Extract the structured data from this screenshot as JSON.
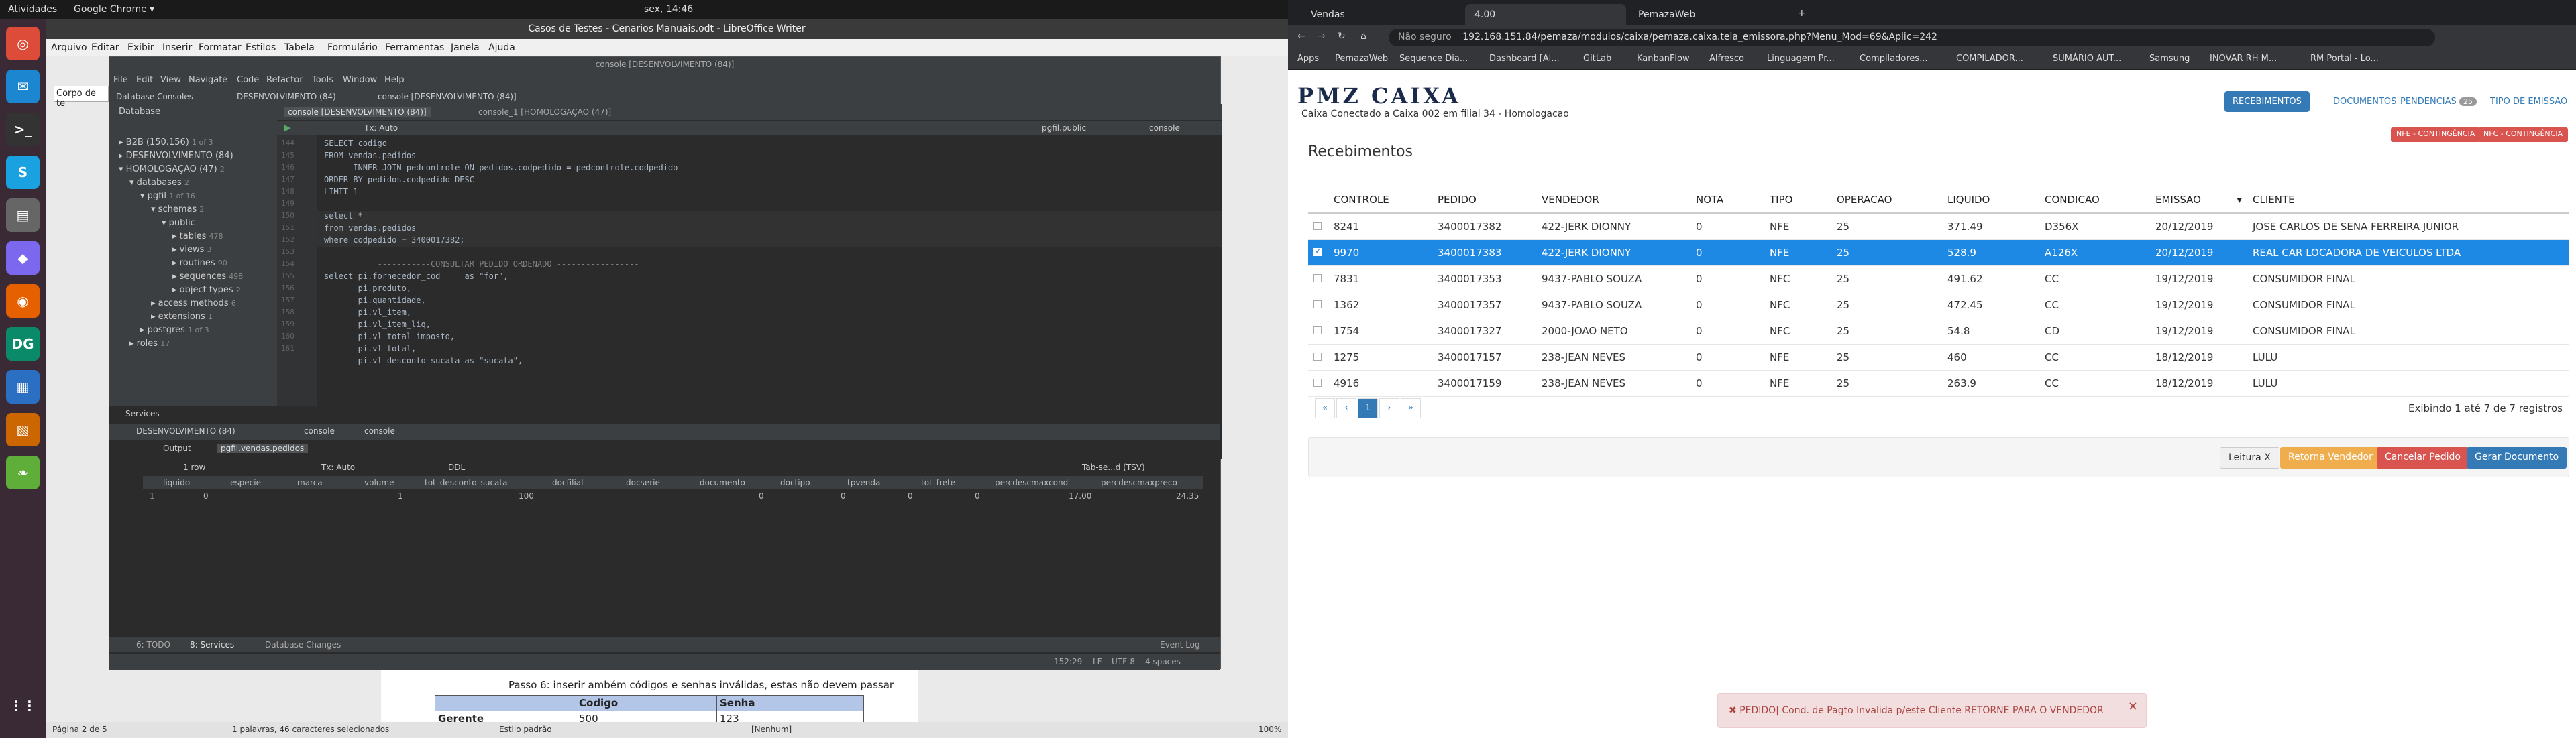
{
  "topbar": {
    "activities": "Atividades",
    "app": "Google Chrome ▾",
    "clock": "sex, 14:46"
  },
  "libreoffice": {
    "title": "Casos de Testes - Cenarios Manuais.odt - LibreOffice Writer",
    "menu": [
      "Arquivo",
      "Editar",
      "Exibir",
      "Inserir",
      "Formatar",
      "Estilos",
      "Tabela",
      "Formulário",
      "Ferramentas",
      "Janela",
      "Ajuda"
    ],
    "style_box": "Corpo de te",
    "step_text": "Passo 6: inserir ambém códigos e senhas inválidas, estas não devem passar",
    "table": {
      "headers": [
        "",
        "Codigo",
        "Senha"
      ],
      "row": [
        "Gerente",
        "500",
        "123"
      ]
    },
    "status": {
      "page": "Página 2 de 5",
      "words": "1 palavras, 46 caracteres selecionados",
      "style": "Estilo padrão",
      "lang": "[Nenhum]",
      "zoom": "100%"
    }
  },
  "ij": {
    "title": "console [DESENVOLVIMENTO (84)]",
    "menu": [
      "File",
      "Edit",
      "View",
      "Navigate",
      "Code",
      "Refactor",
      "Tools",
      "Window",
      "Help"
    ],
    "tabs": [
      "Database Consoles",
      "DESENVOLVIMENTO (84)",
      "console [DESENVOLVIMENTO (84)]"
    ],
    "db_title": "Database",
    "editor_tabs": [
      "console [DESENVOLVIMENTO (84)]",
      "console_1 [HOMOLOGAÇAO (47)]"
    ],
    "tx": "Tx: Auto",
    "schema": "pgfil.public",
    "console_label": "console",
    "tree": [
      {
        "label": "B2B (150.156)",
        "sub": "1 of 3"
      },
      {
        "label": "DESENVOLVIMENTO (84)",
        "sub": ""
      },
      {
        "label": "HOMOLOGAÇAO (47)",
        "sub": "2"
      },
      {
        "label": "databases",
        "sub": "2"
      },
      {
        "label": "pgfil",
        "sub": "1 of 16"
      },
      {
        "label": "schemas",
        "sub": "2"
      },
      {
        "label": "public",
        "sub": ""
      },
      {
        "label": "tables",
        "sub": "478"
      },
      {
        "label": "views",
        "sub": "3"
      },
      {
        "label": "routines",
        "sub": "90"
      },
      {
        "label": "sequences",
        "sub": "498"
      },
      {
        "label": "object types",
        "sub": "2"
      },
      {
        "label": "access methods",
        "sub": "6"
      },
      {
        "label": "extensions",
        "sub": "1"
      },
      {
        "label": "postgres",
        "sub": "1 of 3"
      },
      {
        "label": "roles",
        "sub": "17"
      }
    ],
    "lines": [
      "144",
      "145",
      "146",
      "147",
      "148",
      "149",
      "150",
      "151",
      "152",
      "153",
      "154",
      "155",
      "156",
      "157",
      "158",
      "159",
      "160",
      "161"
    ],
    "code": [
      "SELECT codigo",
      "FROM vendas.pedidos",
      "      INNER JOIN pedcontrole ON pedidos.codpedido = pedcontrole.codpedido",
      "ORDER BY pedidos.codpedido DESC",
      "LIMIT 1",
      "",
      "select *",
      "from vendas.pedidos",
      "where codpedido = 3400017382;",
      "",
      "           -----------CONSULTAR PEDIDO ORDENADO -----------------",
      "select pi.fornecedor_cod     as \"for\",",
      "       pi.produto,",
      "       pi.quantidade,",
      "       pi.vl_item,",
      "       pi.vl_item_liq,",
      "       pi.vl_total_imposto,",
      "       pi.vl_total,",
      "       pi.vl_desconto_sucata as \"sucata\","
    ],
    "services": {
      "title": "Services",
      "tree": [
        "DESENVOLVIMENTO (84)",
        "console",
        "console"
      ],
      "out_tabs": [
        "Output",
        "pgfil.vendas.pedidos"
      ],
      "rows": "1 row",
      "ddl": "DDL",
      "tab_sep": "Tab-se...d (TSV)",
      "columns": [
        "liquido",
        "especie",
        "marca",
        "volume",
        "tot_desconto_sucata",
        "docfilial",
        "docserie",
        "documento",
        "doctipo",
        "tpvenda",
        "tot_frete",
        "percdescmaxcond",
        "percdescmaxpreco"
      ],
      "values": [
        "1",
        "0",
        "",
        "1",
        "100",
        "0",
        "",
        "0",
        "0",
        "0",
        "0",
        "17.00",
        "24.35"
      ]
    },
    "status": {
      "todo": "6: TODO",
      "services": "8: Services",
      "dbchanges": "Database Changes",
      "event": "Event Log",
      "pos": "152:29",
      "lf": "LF",
      "enc": "UTF-8",
      "indent": "4 spaces"
    }
  },
  "chrome": {
    "tabs": [
      "Vendas",
      "4.00",
      "PemazaWeb"
    ],
    "secure": "Não seguro",
    "url": "192.168.151.84/pemaza/modulos/caixa/pemaza.caixa.tela_emissora.php?Menu_Mod=69&Aplic=242",
    "bookmarks": [
      "Apps",
      "PemazaWeb",
      "Sequence Dia...",
      "Dashboard [Al...",
      "GitLab",
      "KanbanFlow",
      "Alfresco",
      "Linguagem Pr...",
      "Compiladores...",
      "COMPILADOR...",
      "SUMÁRIO AUT...",
      "Samsung",
      "INOVAR RH M...",
      "RM Portal - Lo..."
    ]
  },
  "app": {
    "logo_a": "PMZ",
    "logo_b": "CAIXA",
    "caixa_info": "Caixa Conectado a Caixa 002 em filial 34 - Homologacao",
    "nav": [
      "RECEBIMENTOS",
      "DOCUMENTOS",
      "PENDENCIAS",
      "TIPO DE EMISSAO"
    ],
    "pend_count": "25",
    "warn": [
      "NFE - CONTINGÊNCIA",
      "NFC - CONTINGÊNCIA"
    ],
    "title": "Recebimentos",
    "columns": [
      "",
      "CONTROLE",
      "PEDIDO",
      "VENDEDOR",
      "NOTA",
      "TIPO",
      "OPERACAO",
      "LIQUIDO",
      "CONDICAO",
      "EMISSAO",
      "CLIENTE"
    ],
    "rows": [
      [
        "8241",
        "3400017382",
        "422-JERK DIONNY",
        "0",
        "NFE",
        "25",
        "371.49",
        "D356X",
        "20/12/2019",
        "JOSE CARLOS DE SENA FERREIRA JUNIOR"
      ],
      [
        "9970",
        "3400017383",
        "422-JERK DIONNY",
        "0",
        "NFE",
        "25",
        "528.9",
        "A126X",
        "20/12/2019",
        "REAL CAR LOCADORA DE VEICULOS LTDA"
      ],
      [
        "7831",
        "3400017353",
        "9437-PABLO SOUZA",
        "0",
        "NFC",
        "25",
        "491.62",
        "CC",
        "19/12/2019",
        "CONSUMIDOR FINAL"
      ],
      [
        "1362",
        "3400017357",
        "9437-PABLO SOUZA",
        "0",
        "NFC",
        "25",
        "472.45",
        "CC",
        "19/12/2019",
        "CONSUMIDOR FINAL"
      ],
      [
        "1754",
        "3400017327",
        "2000-JOAO NETO",
        "0",
        "NFC",
        "25",
        "54.8",
        "CD",
        "19/12/2019",
        "CONSUMIDOR FINAL"
      ],
      [
        "1275",
        "3400017157",
        "238-JEAN NEVES",
        "0",
        "NFE",
        "25",
        "460",
        "CC",
        "18/12/2019",
        "LULU"
      ],
      [
        "4916",
        "3400017159",
        "238-JEAN NEVES",
        "0",
        "NFE",
        "25",
        "263.9",
        "CC",
        "18/12/2019",
        "LULU"
      ]
    ],
    "pager": [
      "«",
      "‹",
      "1",
      "›",
      "»"
    ],
    "count": "Exibindo 1 até 7 de 7 registros",
    "buttons": [
      {
        "label": "Leitura X",
        "color": "#f0f0f0",
        "text": "#333"
      },
      {
        "label": "Retorna Vendedor",
        "color": "#f0ad4e",
        "text": "#fff"
      },
      {
        "label": "Cancelar Pedido",
        "color": "#d9534f",
        "text": "#fff"
      },
      {
        "label": "Gerar Documento",
        "color": "#337ab7",
        "text": "#fff"
      }
    ],
    "toast": "PEDIDO| Cond. de Pagto Invalida p/este Cliente RETORNE PARA O VENDEDOR"
  }
}
